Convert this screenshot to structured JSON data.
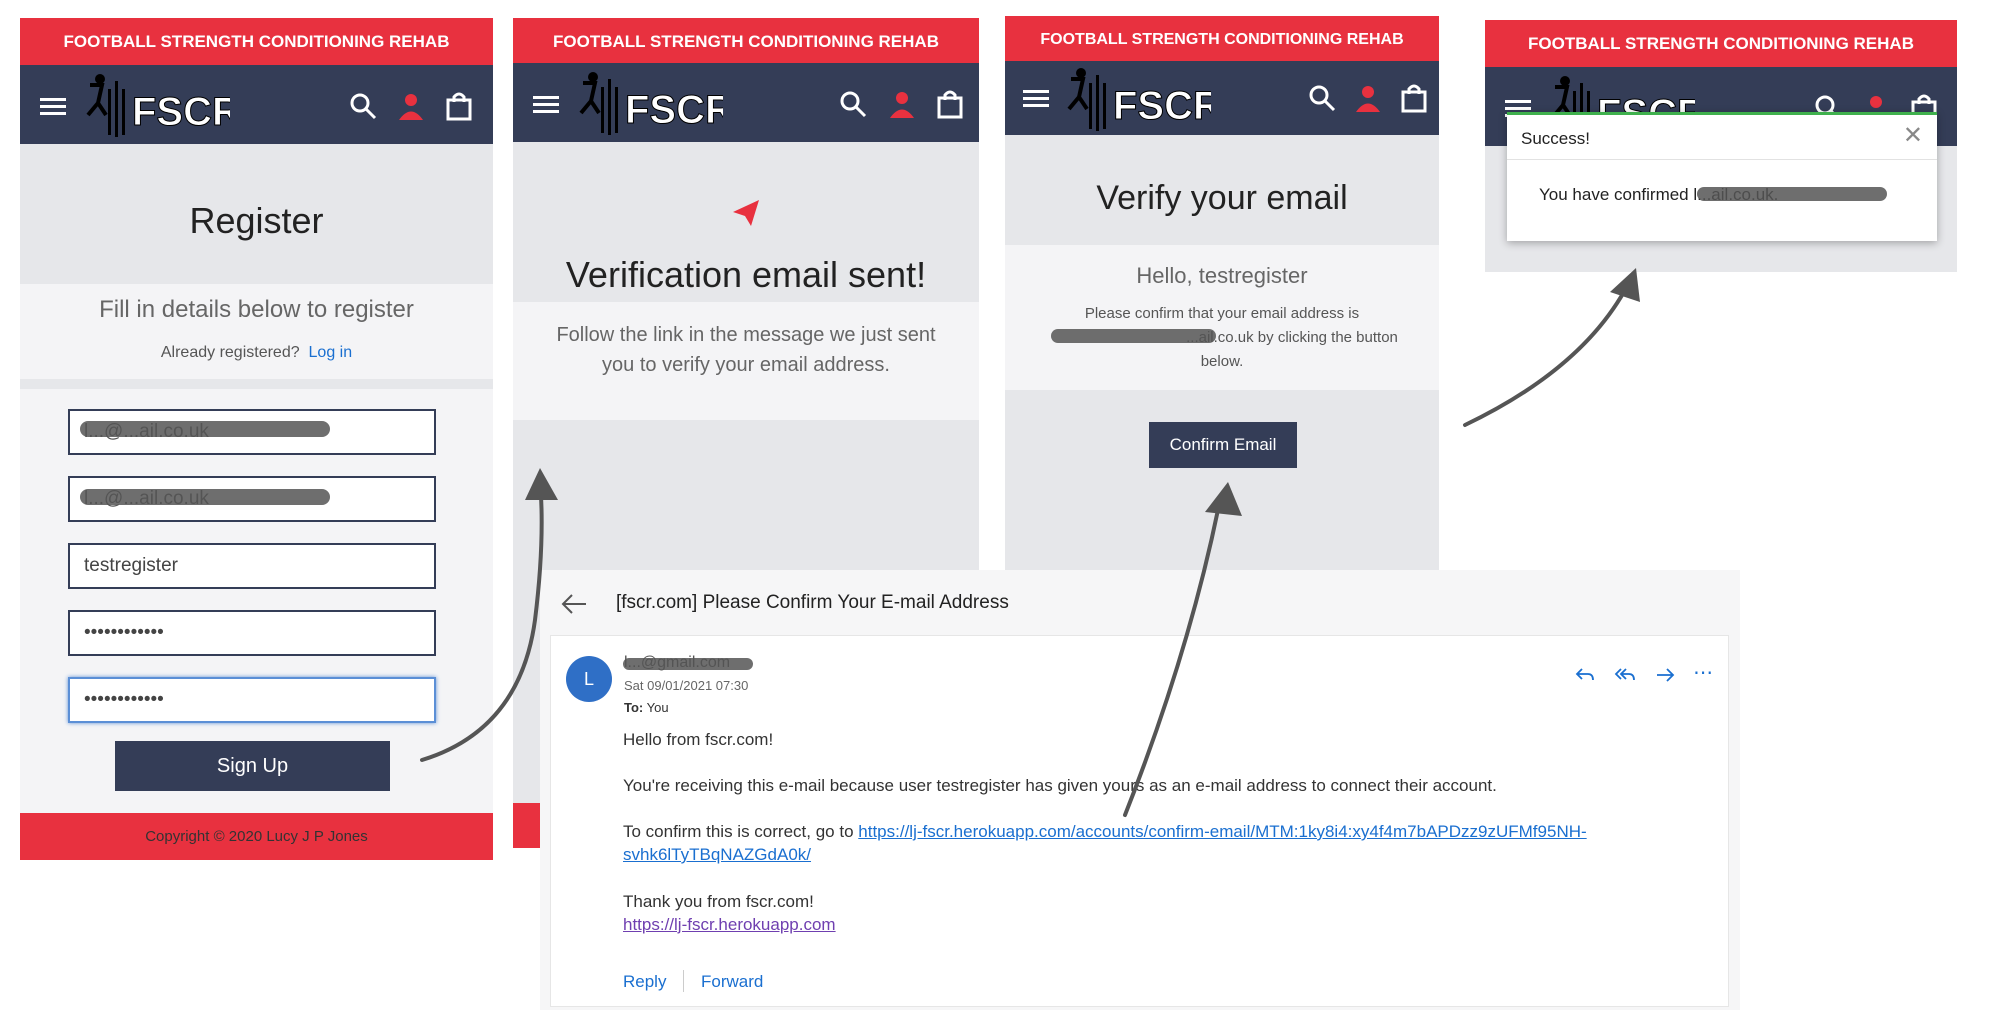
{
  "site": {
    "banner": "FOOTBALL STRENGTH CONDITIONING REHAB",
    "logo_text": "FSCR"
  },
  "register": {
    "title": "Register",
    "subtitle": "Fill in details below to register",
    "already_text": "Already registered?",
    "login_link": "Log in",
    "fields": [
      {
        "name": "email",
        "value": "l...@...ail.co.uk"
      },
      {
        "name": "email-confirm",
        "value": "l...@...ail.co.uk"
      },
      {
        "name": "username",
        "value": "testregister"
      },
      {
        "name": "password",
        "value": "••••••••••••"
      },
      {
        "name": "password-confirm",
        "value": "••••••••••••"
      }
    ],
    "signup_label": "Sign Up",
    "footer": "Copyright © 2020 Lucy J P Jones"
  },
  "verification_sent": {
    "title": "Verification email sent!",
    "message": "Follow the link in the message we just sent you to verify your email address."
  },
  "verify": {
    "title": "Verify your email",
    "greeting": "Hello, testregister",
    "line1": "Please confirm that your email address is",
    "line2_suffix": "...ail.co.uk by clicking the button",
    "line3": "below.",
    "button": "Confirm Email"
  },
  "success": {
    "title": "Success!",
    "message": "You have confirmed l...ail.co.uk."
  },
  "email": {
    "subject": "[fscr.com] Please Confirm Your E-mail Address",
    "sender_initial": "L",
    "sender": "l...@gmail.com",
    "date": "Sat 09/01/2021 07:30",
    "to_label": "To:",
    "to_value": "You",
    "greeting": "Hello from fscr.com!",
    "body1": "You're receiving this e-mail because user testregister has given yours as an e-mail address to connect their account.",
    "confirm_prefix": "To confirm this is correct, go to",
    "confirm_link_1": "https://lj-fscr.herokuapp.com/accounts/confirm-email/MTM:1ky8i4:xy4f4m7bAPDzz9zUFMf95NH-",
    "confirm_link_2": "svhk6lTyTBqNAZGdA0k/",
    "thanks": "Thank you from fscr.com!",
    "site_link": "https://lj-fscr.herokuapp.com",
    "reply": "Reply",
    "forward": "Forward"
  },
  "colors": {
    "accent_red": "#e8313f",
    "navy": "#343d57",
    "link_blue": "#1a6fd0"
  }
}
